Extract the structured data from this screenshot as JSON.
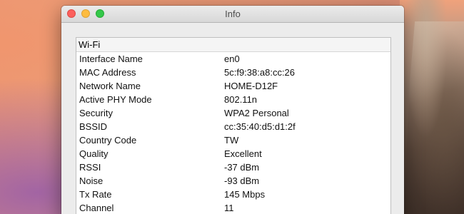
{
  "window": {
    "title": "Info"
  },
  "info": {
    "section_title": "Wi-Fi",
    "rows": [
      {
        "label": "Interface Name",
        "value": "en0"
      },
      {
        "label": "MAC Address",
        "value": "5c:f9:38:a8:cc:26"
      },
      {
        "label": "Network Name",
        "value": "HOME-D12F"
      },
      {
        "label": "Active PHY Mode",
        "value": "802.11n"
      },
      {
        "label": "Security",
        "value": "WPA2 Personal"
      },
      {
        "label": "BSSID",
        "value": "cc:35:40:d5:d1:2f"
      },
      {
        "label": "Country Code",
        "value": "TW"
      },
      {
        "label": "Quality",
        "value": "Excellent"
      },
      {
        "label": "RSSI",
        "value": "-37 dBm"
      },
      {
        "label": "Noise",
        "value": "-93 dBm"
      },
      {
        "label": "Tx Rate",
        "value": "145 Mbps"
      },
      {
        "label": "Channel",
        "value": "11"
      }
    ]
  },
  "colors": {
    "close": "#fc605c",
    "minimize": "#fdbc40",
    "zoom": "#34c84a"
  }
}
